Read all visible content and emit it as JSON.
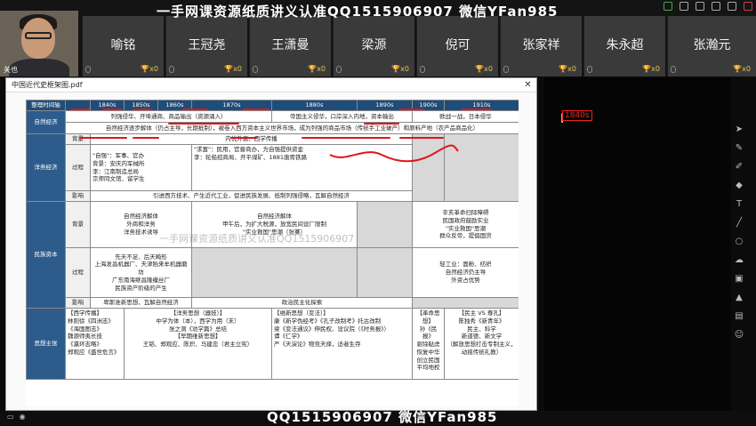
{
  "watermark": {
    "top": "一手网课资源纸质讲义认准QQ1515906907 微信YFan985",
    "bottom_line1": "一手网课资源纸质讲义认准",
    "bottom_line2": "QQ1515906907 微信YFan985",
    "mid": "一手网课资源纸质讲义认准QQ1515906907"
  },
  "participants": {
    "self": {
      "name": "关也"
    },
    "others": [
      {
        "name": "喻铭",
        "score": "x0"
      },
      {
        "name": "王冠尧",
        "score": "x0"
      },
      {
        "name": "王潇曼",
        "score": "x0"
      },
      {
        "name": "梁源",
        "score": "x0"
      },
      {
        "name": "倪可",
        "score": "x0"
      },
      {
        "name": "张家祥",
        "score": "x0"
      },
      {
        "name": "朱永超",
        "score": "x0"
      },
      {
        "name": "张瀚元",
        "score": "x0"
      }
    ]
  },
  "pdf": {
    "title": "中国近代史框架图.pdf",
    "close_label": "✕",
    "header": [
      "整理时间轴",
      "1840s",
      "1850s",
      "1860s",
      "1870s",
      "1880s",
      "1890s",
      "1900s",
      "1910s"
    ],
    "rows": {
      "natural": {
        "label": "自然经济",
        "line1": "列强侵华、开埠通商、商品输出（资源涌入）",
        "line1b": "帝国主义侵华，口岸深入内地，资本输出",
        "line1c": "欧战一战，日本侵华",
        "line2": "自然经济逐步解体（仍占主导，长期抵制），被卷入西方资本主义世界市场，成为列强的商品市场（传统手工业破产）和原料产地（农产品商品化）"
      },
      "westernization": {
        "label": "洋务经济",
        "sub_bg": "背景",
        "sub_proc": "过程",
        "sub_impact": "影响",
        "bg_text": "内忧外患、西学传播",
        "proc_left": "\"自强\"：军事、官办\n背景：安庆内军械所\n李：江南制造总局\n京师同文馆、留学生",
        "proc_right": "\"求富\"：民用，官督商办，为自强提供资金\n李：轮船招商局、开平煤矿、1881唐胥铁路",
        "impact_text": "引进西方技术、产生近代工业，促进民族发展、抵制列强侵略，瓦解自然经济"
      },
      "national": {
        "label": "民族资本",
        "sub_bg": "背景",
        "sub_proc": "过程",
        "sub_impact": "影响",
        "bg_left": "自然经济解体\n外商和洋务\n洋务技术诱导",
        "bg_mid": "自然经济解体\n甲午后，为扩大税源，放宽民间设厂限制\n\"实业救国\"思潮（张謇）",
        "bg_right": "辛亥革命扫除障碍\n民国政府鼓励实业\n\"实业救国\"思潮\n群众反帝，提倡国货",
        "proc_left": "先天不足、后天畸形\n上海发昌机器厂、天津贻来牟机器磨坊\n广东南海继昌隆缫丝厂\n民族资产阶级的产生",
        "proc_right": "轻工业：面粉、纺织\n自然经济仍主导\n外资占优势",
        "impact_left": "卑斯准新思想、瓦解自然经济",
        "impact_mid": "政治民主化探索"
      },
      "thought": {
        "label": "思想主张",
        "c1": "【西学传播】\n林则徐《四洲志》\n《海国图志》\n魏源师夷长技\n《瀛环志略》\n郑观应《盛世危言》",
        "c2": "【洋务思想（器技）】\n中学为体（本），西学为用（末）\n张之洞《劝学篇》总结\n【早期维新思想】\n王韬、郑观应、陈炽、马建忠（君主立宪）",
        "c3": "【维新思想（变法）】\n康《新学伪经考》《孔子改制考》托古改制\n梁《变法通议》伸民权、设议院（《时务报》）\n谭《仁学》\n严《天演论》物竞天择，适者生存",
        "c4": "【革命思想】\n孙《民报》\n驱除鞑虏\n恢复中华\n创立民国\n平均地权",
        "c5": "【民主 VS 尊孔】\n陈独秀《新青年》\n民主、科学\n新道德、新文学\n（解放思想打击专制主义，动摇传统礼教）"
      }
    }
  },
  "annotation": "1840s",
  "colors": {
    "accent_red": "#e0141e",
    "table_header": "#1f4d7a",
    "label_blue": "#2d5c8c"
  }
}
